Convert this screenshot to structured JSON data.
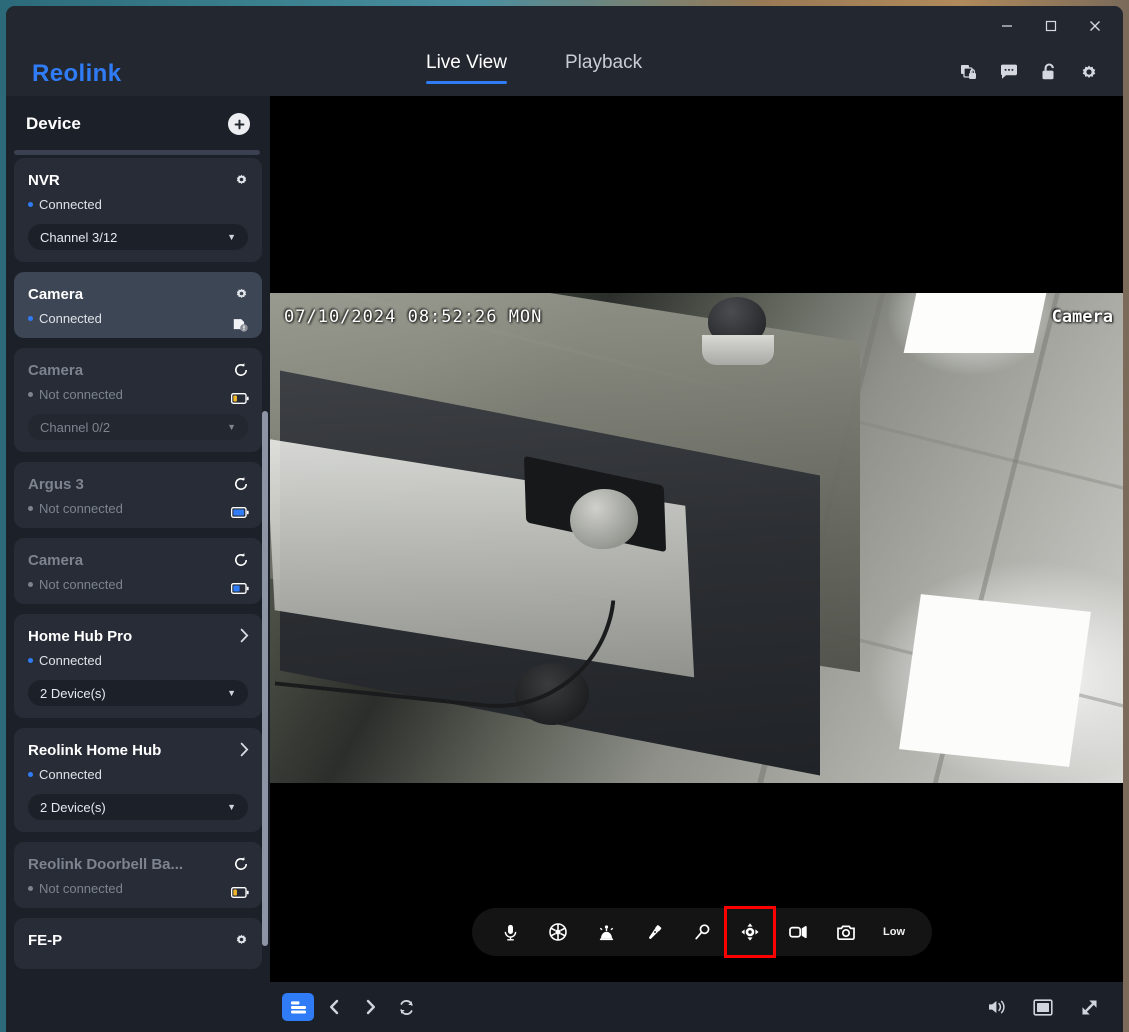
{
  "window": {
    "controls": {
      "minimize": "minimize-button",
      "maximize": "maximize-button",
      "close": "close-button"
    }
  },
  "header": {
    "logo": "Reolink",
    "tabs": [
      {
        "label": "Live View",
        "active": true
      },
      {
        "label": "Playback",
        "active": false
      }
    ],
    "icons": [
      "files-lock-icon",
      "chat-icon",
      "unlock-icon",
      "gear-icon"
    ]
  },
  "sidebar": {
    "title": "Device",
    "add_label": "+",
    "devices": [
      {
        "name": "NVR",
        "status": "Connected",
        "connected": true,
        "action": "gear-icon",
        "select": "Channel 3/12",
        "selected": false,
        "badge": null
      },
      {
        "name": "Camera",
        "status": "Connected",
        "connected": true,
        "action": "gear-icon",
        "select": null,
        "selected": true,
        "badge": "sd-card-alert-icon"
      },
      {
        "name": "Camera",
        "status": "Not connected",
        "connected": false,
        "action": "refresh-icon",
        "select": "Channel 0/2",
        "selected": false,
        "badge": "battery-low-icon"
      },
      {
        "name": "Argus 3",
        "status": "Not connected",
        "connected": false,
        "action": "refresh-icon",
        "select": null,
        "selected": false,
        "badge": "battery-full-icon"
      },
      {
        "name": "Camera",
        "status": "Not connected",
        "connected": false,
        "action": "refresh-icon",
        "select": null,
        "selected": false,
        "badge": "battery-half-icon"
      },
      {
        "name": "Home Hub Pro",
        "status": "Connected",
        "connected": true,
        "action": "chevron-right-icon",
        "select": "2 Device(s)",
        "selected": false,
        "badge": null
      },
      {
        "name": "Reolink Home Hub",
        "status": "Connected",
        "connected": true,
        "action": "chevron-right-icon",
        "select": "2 Device(s)",
        "selected": false,
        "badge": null
      },
      {
        "name": "Reolink Doorbell Ba...",
        "status": "Not connected",
        "connected": false,
        "action": "refresh-icon",
        "select": null,
        "selected": false,
        "badge": "battery-low-icon"
      },
      {
        "name": "FE-P",
        "status": "",
        "connected": true,
        "action": "gear-icon",
        "select": null,
        "selected": false,
        "badge": null
      }
    ]
  },
  "video": {
    "timestamp": "07/10/2024  08:52:26  MON",
    "camera_label": "Camera"
  },
  "toolbar": {
    "buttons": [
      {
        "name": "microphone-icon",
        "label": "",
        "highlighted": false
      },
      {
        "name": "ptz-wheel-icon",
        "label": "",
        "highlighted": false
      },
      {
        "name": "siren-icon",
        "label": "",
        "highlighted": false
      },
      {
        "name": "spotlight-icon",
        "label": "",
        "highlighted": false
      },
      {
        "name": "zoom-icon",
        "label": "",
        "highlighted": false
      },
      {
        "name": "ptz-control-icon",
        "label": "",
        "highlighted": true
      },
      {
        "name": "record-icon",
        "label": "",
        "highlighted": false
      },
      {
        "name": "snapshot-icon",
        "label": "",
        "highlighted": false
      },
      {
        "name": "quality-label",
        "label": "Low",
        "highlighted": false
      }
    ]
  },
  "bottombar": {
    "left": [
      "layout-grid-icon",
      "prev-icon",
      "next-icon",
      "refresh-icon"
    ],
    "right": [
      "volume-icon",
      "pip-icon",
      "fullscreen-icon"
    ]
  },
  "colors": {
    "accent": "#2f7cf6",
    "highlight": "#ff0000",
    "panel": "#1c2029",
    "card": "#272c36",
    "card_selected": "#3d4654"
  }
}
